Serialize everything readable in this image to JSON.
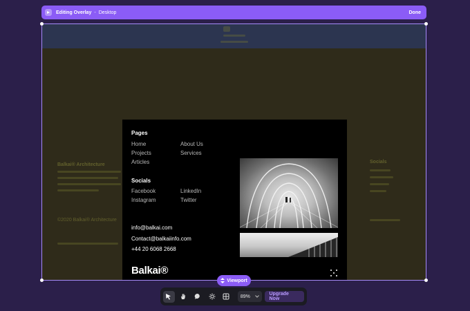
{
  "topbar": {
    "title": "Editing Overlay",
    "separator": "-",
    "mode": "Desktop",
    "done_label": "Done",
    "accent": "#8b5cf6"
  },
  "background_page": {
    "brand_heading": "Balkai® Architecture",
    "socials_heading": "Socials",
    "copyright": "©2020 Balkai® Architecture"
  },
  "card": {
    "pages_heading": "Pages",
    "pages_col1": [
      "Home",
      "Projects",
      "Articles"
    ],
    "pages_col2": [
      "About Us",
      "Services"
    ],
    "socials_heading": "Socials",
    "socials_col1": [
      "Facebook",
      "Instagram"
    ],
    "socials_col2": [
      "LinkedIn",
      "Twitter"
    ],
    "email1": "info@balkai.com",
    "email2": "Contact@balkaiinfo.com",
    "phone": "+44 20 6068 2668",
    "brand": "Balkai®"
  },
  "viewport": {
    "label": "Viewport"
  },
  "toolbar": {
    "tools": [
      "cursor-icon",
      "hand-icon",
      "comment-icon",
      "sun-icon",
      "grid-icon"
    ],
    "zoom": "89%",
    "upgrade_label": "Upgrade Now"
  }
}
